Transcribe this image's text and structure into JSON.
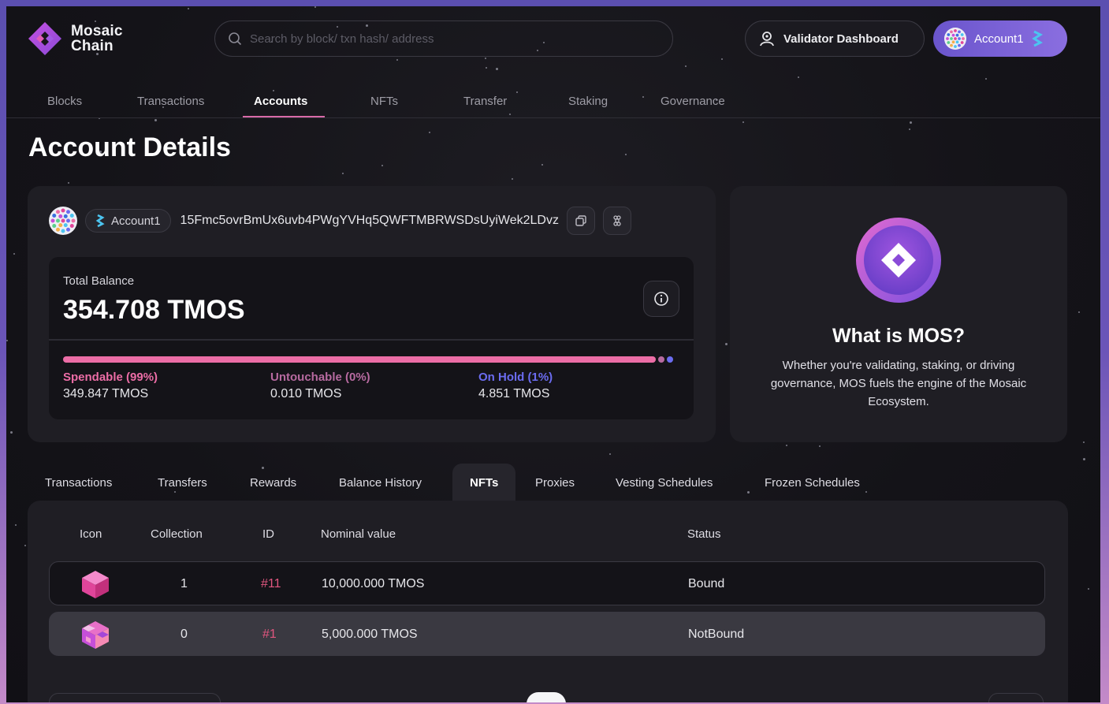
{
  "brand": {
    "line1": "Mosaic",
    "line2": "Chain"
  },
  "search": {
    "placeholder": "Search by block/ txn hash/ address"
  },
  "header": {
    "validator_label": "Validator Dashboard",
    "account_label": "Account1"
  },
  "nav": [
    "Blocks",
    "Transactions",
    "Accounts",
    "NFTs",
    "Transfer",
    "Staking",
    "Governance"
  ],
  "nav_active": "Accounts",
  "page_title": "Account Details",
  "account": {
    "name": "Account1",
    "address": "15Fmc5ovrBmUx6uvb4PWgYVHq5QWFTMBRWSDsUyiWek2LDvz"
  },
  "balance": {
    "label": "Total Balance",
    "total": "354.708 TMOS",
    "spendable_fraction": 0.99,
    "untouchable_fraction": 0.0,
    "on_hold_fraction": 0.01,
    "spendable": {
      "label": "Spendable (99%)",
      "amount": "349.847 TMOS"
    },
    "untouchable": {
      "label": "Untouchable (0%)",
      "amount": "0.010 TMOS"
    },
    "on_hold": {
      "label": "On Hold (1%)",
      "amount": "4.851 TMOS"
    }
  },
  "info": {
    "title": "What is MOS?",
    "text": "Whether you're validating, staking, or driving governance, MOS fuels the engine of the Mosaic Ecosystem."
  },
  "tabs": [
    "Transactions",
    "Transfers",
    "Rewards",
    "Balance History",
    "NFTs",
    "Proxies",
    "Vesting Schedules",
    "Frozen Schedules"
  ],
  "tab_active": "NFTs",
  "table": {
    "headers": [
      "Icon",
      "Collection",
      "ID",
      "Nominal value",
      "Status"
    ],
    "rows": [
      {
        "collection": "1",
        "id": "#11",
        "value": "10,000.000 TMOS",
        "status": "Bound"
      },
      {
        "collection": "0",
        "id": "#1",
        "value": "5,000.000 TMOS",
        "status": "NotBound"
      }
    ]
  },
  "colors": {
    "accent_pink": "#ec6da6",
    "untouchable": "#b76aa0",
    "on_hold": "#6b6cf0",
    "id_link": "#e0567f",
    "account_button": "#7a60d6"
  }
}
